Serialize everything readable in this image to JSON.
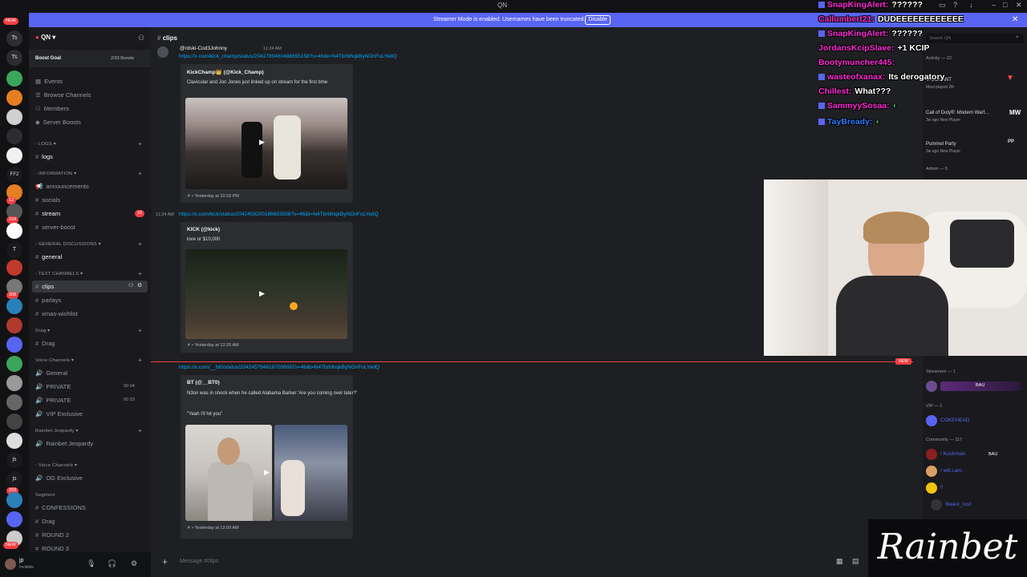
{
  "window": {
    "title": "QN"
  },
  "banner": {
    "message": "Streamer Mode is enabled. Usernames have been truncated.",
    "disable_label": "Disable",
    "bg": "#5865f2"
  },
  "server": {
    "name": "QN",
    "boost_goal": "Boost Goal",
    "boosts": "2/33 Boosts"
  },
  "menu": {
    "events": "Events",
    "browse": "Browse Channels",
    "members": "Members",
    "server_boosts": "Server Boosts"
  },
  "categories": {
    "logs": "LOGS",
    "information": "INFORMATION",
    "general_discussions": "GENERAL DISCUSSIONS",
    "text_channels": "TEXT CHANNELS",
    "drag": "Drag",
    "voice_channels": "Voice Channels",
    "rainbet_jeopardy": "Rainbet Jeopardy",
    "voice_channels2": "Voice Channels",
    "segment": "Segment"
  },
  "channels": {
    "logs": "logs",
    "announcements": "announcements",
    "socials": "socials",
    "stream": "stream",
    "stream_badge": "19",
    "server_boost": "server-boost",
    "general": "general",
    "clips": "clips",
    "parlays": "parlays",
    "xmas_wishlist": "xmas-wishlist",
    "drag": "Drag",
    "voice_general": "General",
    "private1": "PRIVATE",
    "private1_count": "00 04",
    "private2": "PRIVATE",
    "private2_count": "00 03",
    "vip_exclusive": "VIP Exclusive",
    "rainbet_jeopardy": "Rainbet Jeopardy",
    "og_exclusive": "OG Exclusive",
    "confessions": "CONFESSIONS",
    "drag2": "Drag",
    "round2": "ROUND 2",
    "round3": "ROUND 3"
  },
  "server_icon_badges": {
    "new_top": "NEW",
    "b1": "12",
    "b2": "234",
    "b3": "308",
    "b4": "203",
    "new_bottom": "NEW"
  },
  "server_icon_labels": {
    "ts1": "Ts",
    "ts2": "Ts",
    "ff2": "FF2",
    "t": "T",
    "js1": "js",
    "js2": "js"
  },
  "chat": {
    "channel_name": "clips",
    "top_user": "@rdski-Cod3Johnny",
    "top_time": "11:24 AM",
    "messages": [
      {
        "link": "https://x.com/kick_champ/status/2042789460488655158?s=46&t=N4TbrblhqkByNOnFoLYedQ",
        "author": "KickChamp👑 (@Kick_Champ)",
        "desc": "Clavicular and Jon Jones just linked up on stream for the first time",
        "footer": "Yesterday at 10:18 PM"
      },
      {
        "time": "11:24 AM",
        "link": "https://x.com/kick/status/2042459200186683558?s=46&t=N4TbrblhqkByNOnFoLYedQ",
        "author": "KICK (@kick)",
        "desc": "love or $10,000",
        "footer": "Yesterday at 12:26 AM"
      },
      {
        "link": "https://x.com/__bt0/status/2042457948167008087s=46&t=N4TbrblhqkByNOnFoLYedQ",
        "author": "BT (@__BT0)",
        "desc": "N3on was in shock when he called Alabama Barker 'Are you coming over later?'",
        "desc2": "\"Yeah I'll hit you\"",
        "footer": "Yesterday at 12:09 AM"
      }
    ],
    "composer_placeholder": "Message #clips"
  },
  "members": {
    "search": "Search QN",
    "activity": "Activity — 22",
    "activities": [
      {
        "title": "VALORANT",
        "sub": "Most played 2th"
      },
      {
        "title": "Call of Duty®: Modern Warf...",
        "sub": "3w ago  New Player"
      },
      {
        "title": "Pummel Party",
        "sub": "3w ago  New Player"
      }
    ],
    "admin": "Admin — 5",
    "streamers": "Streamers — 1",
    "vip": "VIP — 1",
    "vip_member": "COKEHEAD",
    "community": "Community — 117",
    "community_members": [
      "! Kushman",
      "! will.i.am.",
      "!!",
      "!beast_rust"
    ],
    "bau": "BAU"
  },
  "overlay_chat": [
    {
      "user": "SnapKingAlert:",
      "msg": "??????",
      "color": "#ff2bd6"
    },
    {
      "user": "Callumbert21:",
      "msg": "DUDEEEEEEEEEEEE",
      "color": "#ff2bd6"
    },
    {
      "user": "SnapKingAlert:",
      "msg": "??????",
      "color": "#ff2bd6"
    },
    {
      "user": "JordansKcipSlave:",
      "msg": "+1 KCIP",
      "color": "#ff2bd6"
    },
    {
      "user": "Bootymuncher445:",
      "msg": "",
      "color": "#ff2bd6"
    },
    {
      "user": "wasteofxanax:",
      "msg": "Its derogatory",
      "color": "#ff2bd6"
    },
    {
      "user": "Chillest:",
      "msg": "What???",
      "color": "#ff2bd6"
    },
    {
      "user": "SammyySosaa:",
      "msg": "",
      "color": "#ff2bd6"
    },
    {
      "user": "TayBready:",
      "msg": "",
      "color": "#2f7bff"
    }
  ],
  "brand": {
    "logo_text": "Rainbet"
  },
  "user": {
    "name": "jp",
    "status": "Invisible"
  }
}
